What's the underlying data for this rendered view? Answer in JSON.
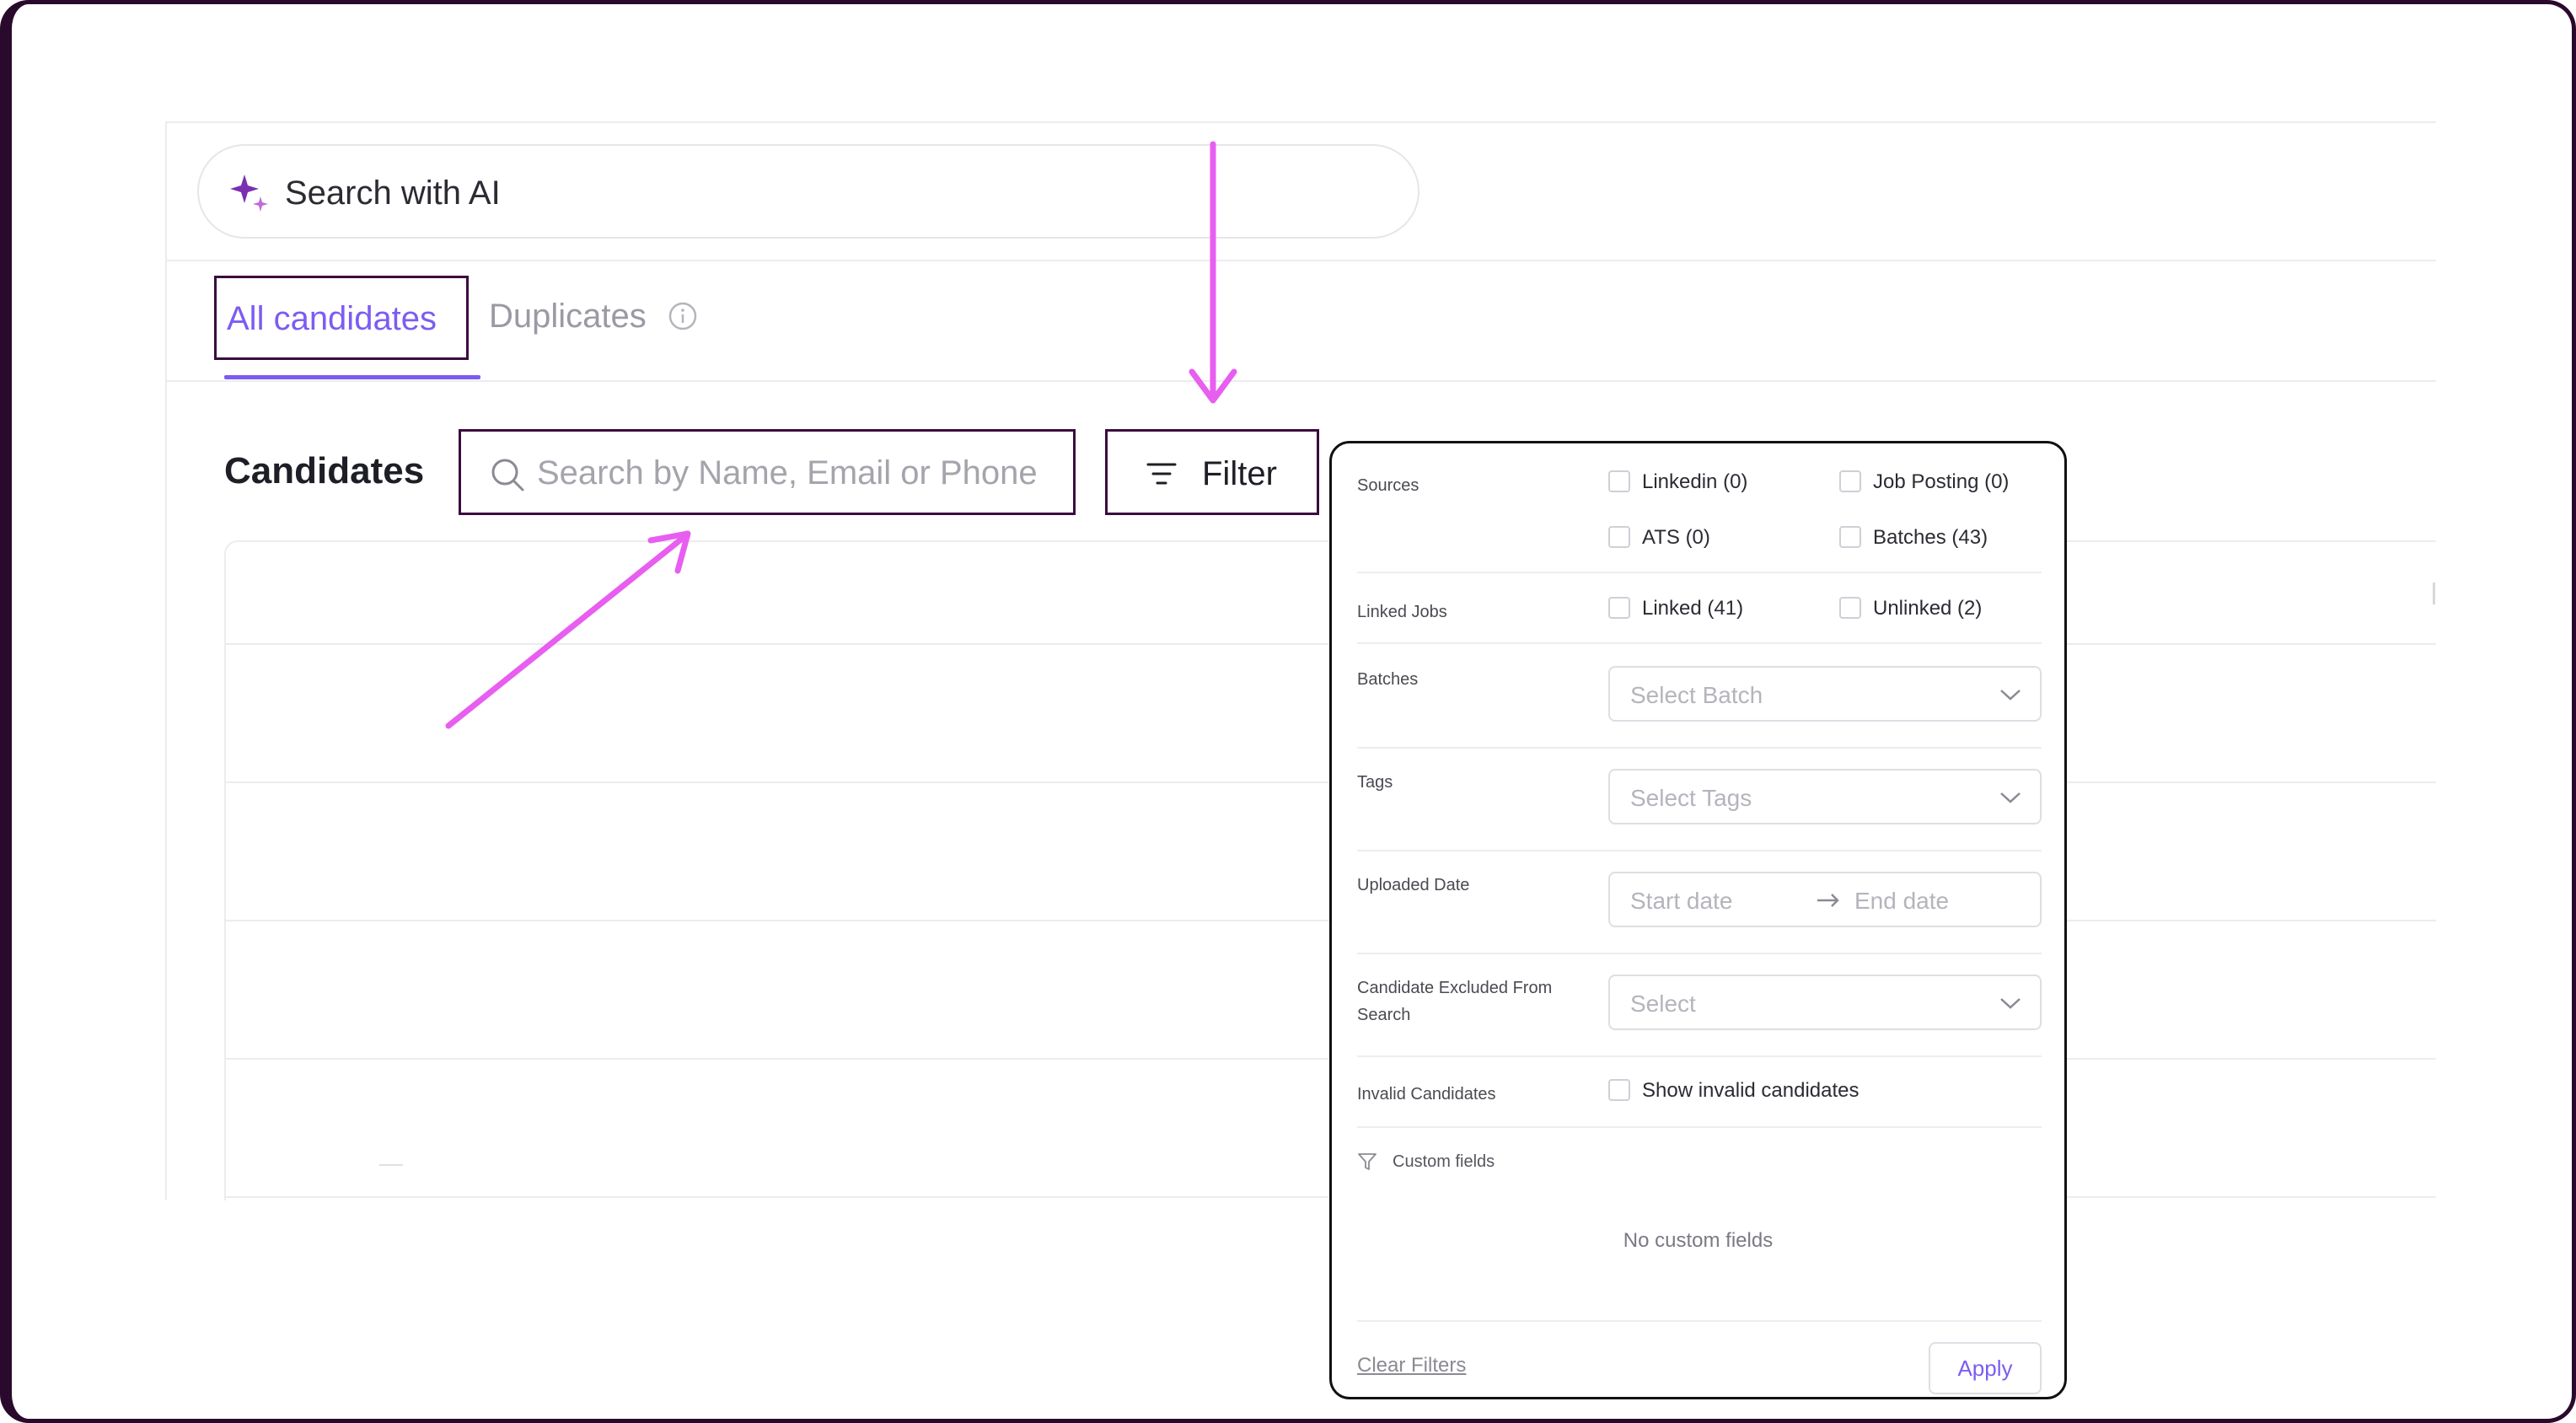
{
  "ai_search": {
    "label": "Search with AI"
  },
  "tabs": [
    {
      "label": "All candidates",
      "active": true
    },
    {
      "label": "Duplicates",
      "active": false
    }
  ],
  "candidates": {
    "title": "Candidates",
    "search_placeholder": "Search by Name, Email or Phone",
    "filter_label": "Filter"
  },
  "filter_panel": {
    "sources": {
      "label": "Sources",
      "options": [
        "Linkedin (0)",
        "Job Posting (0)",
        "ATS (0)",
        "Batches (43)"
      ]
    },
    "linked_jobs": {
      "label": "Linked Jobs",
      "options": [
        "Linked (41)",
        "Unlinked (2)"
      ]
    },
    "batches": {
      "label": "Batches",
      "placeholder": "Select Batch"
    },
    "tags": {
      "label": "Tags",
      "placeholder": "Select Tags"
    },
    "uploaded_date": {
      "label": "Uploaded Date",
      "start_placeholder": "Start date",
      "end_placeholder": "End date"
    },
    "excluded": {
      "label_line1": "Candidate Excluded From",
      "label_line2": "Search",
      "placeholder": "Select"
    },
    "invalid": {
      "label": "Invalid Candidates",
      "option": "Show invalid candidates"
    },
    "custom_fields": {
      "label": "Custom fields",
      "empty_text": "No custom fields"
    },
    "clear_label": "Clear Filters",
    "apply_label": "Apply"
  },
  "colors": {
    "accent": "#7c5cf2",
    "highlight_box": "#3b0b3f",
    "annotation_arrow": "#e85ef0",
    "frame": "#2a0a2c",
    "sparkle": "#7a2fb0"
  },
  "icons": {
    "ai": "sparkle-icon",
    "info": "info-icon",
    "search": "search-icon",
    "filter": "filter-lines-icon",
    "chevron": "chevron-down-icon",
    "date_arrow": "arrow-right-icon",
    "custom_fields": "funnel-icon"
  }
}
